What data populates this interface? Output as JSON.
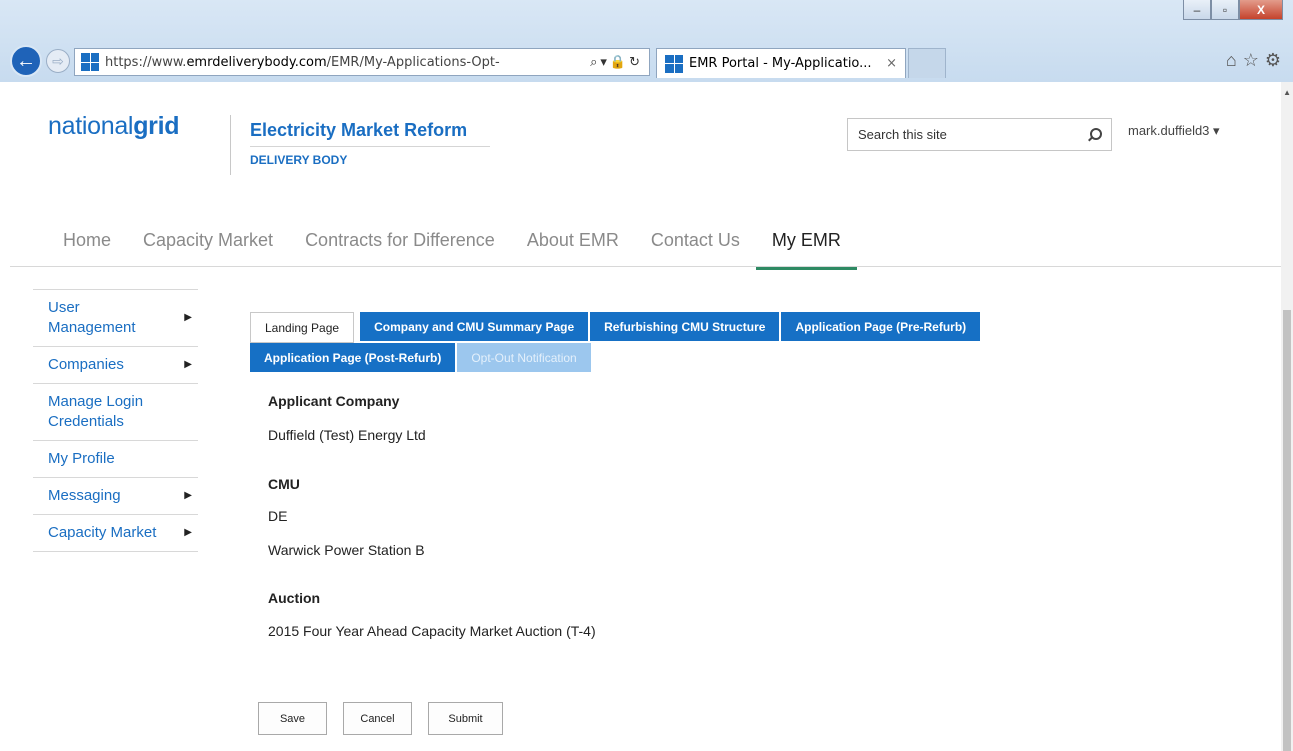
{
  "browser": {
    "url_prefix": "https://www.",
    "url_domain": "emrdeliverybody.com",
    "url_path": "/EMR/My-Applications-Opt-",
    "tab_title": "EMR Portal - My-Applicatio...",
    "tab_close": "×",
    "minimize": "–",
    "restore": "▫",
    "close": "X"
  },
  "header": {
    "logo_light": "national",
    "logo_bold": "grid",
    "title": "Electricity Market Reform",
    "subtitle": "DELIVERY BODY",
    "search_placeholder": "Search this site",
    "user": "mark.duffield3 ▾"
  },
  "nav": {
    "items": [
      "Home",
      "Capacity Market",
      "Contracts for Difference",
      "About EMR",
      "Contact Us",
      "My EMR"
    ],
    "active": "My EMR",
    "accent_color": "#2e8a63"
  },
  "sidebar": {
    "items": [
      {
        "label": "User\nManagement",
        "has_arrow": true
      },
      {
        "label": "Companies",
        "has_arrow": true
      },
      {
        "label": "Manage Login\nCredentials",
        "has_arrow": false
      },
      {
        "label": "My Profile",
        "has_arrow": false
      },
      {
        "label": "Messaging",
        "has_arrow": true
      },
      {
        "label": "Capacity Market",
        "has_arrow": true
      }
    ],
    "arrow": "▶"
  },
  "tabs": {
    "row1": [
      "Landing Page",
      "Company and CMU Summary Page",
      "Refurbishing CMU Structure",
      "Application Page (Pre-Refurb)"
    ],
    "row2": [
      "Application Page (Post-Refurb)",
      "Opt-Out Notification"
    ],
    "active_color": "#1670c5"
  },
  "form": {
    "applicant_label": "Applicant Company",
    "applicant_value": "Duffield (Test) Energy Ltd",
    "cmu_label": "CMU",
    "cmu_code": "DE",
    "cmu_name": "Warwick Power Station B",
    "auction_label": "Auction",
    "auction_value": "2015 Four Year Ahead Capacity Market Auction (T-4)"
  },
  "actions": {
    "save": "Save",
    "cancel": "Cancel",
    "submit": "Submit"
  }
}
